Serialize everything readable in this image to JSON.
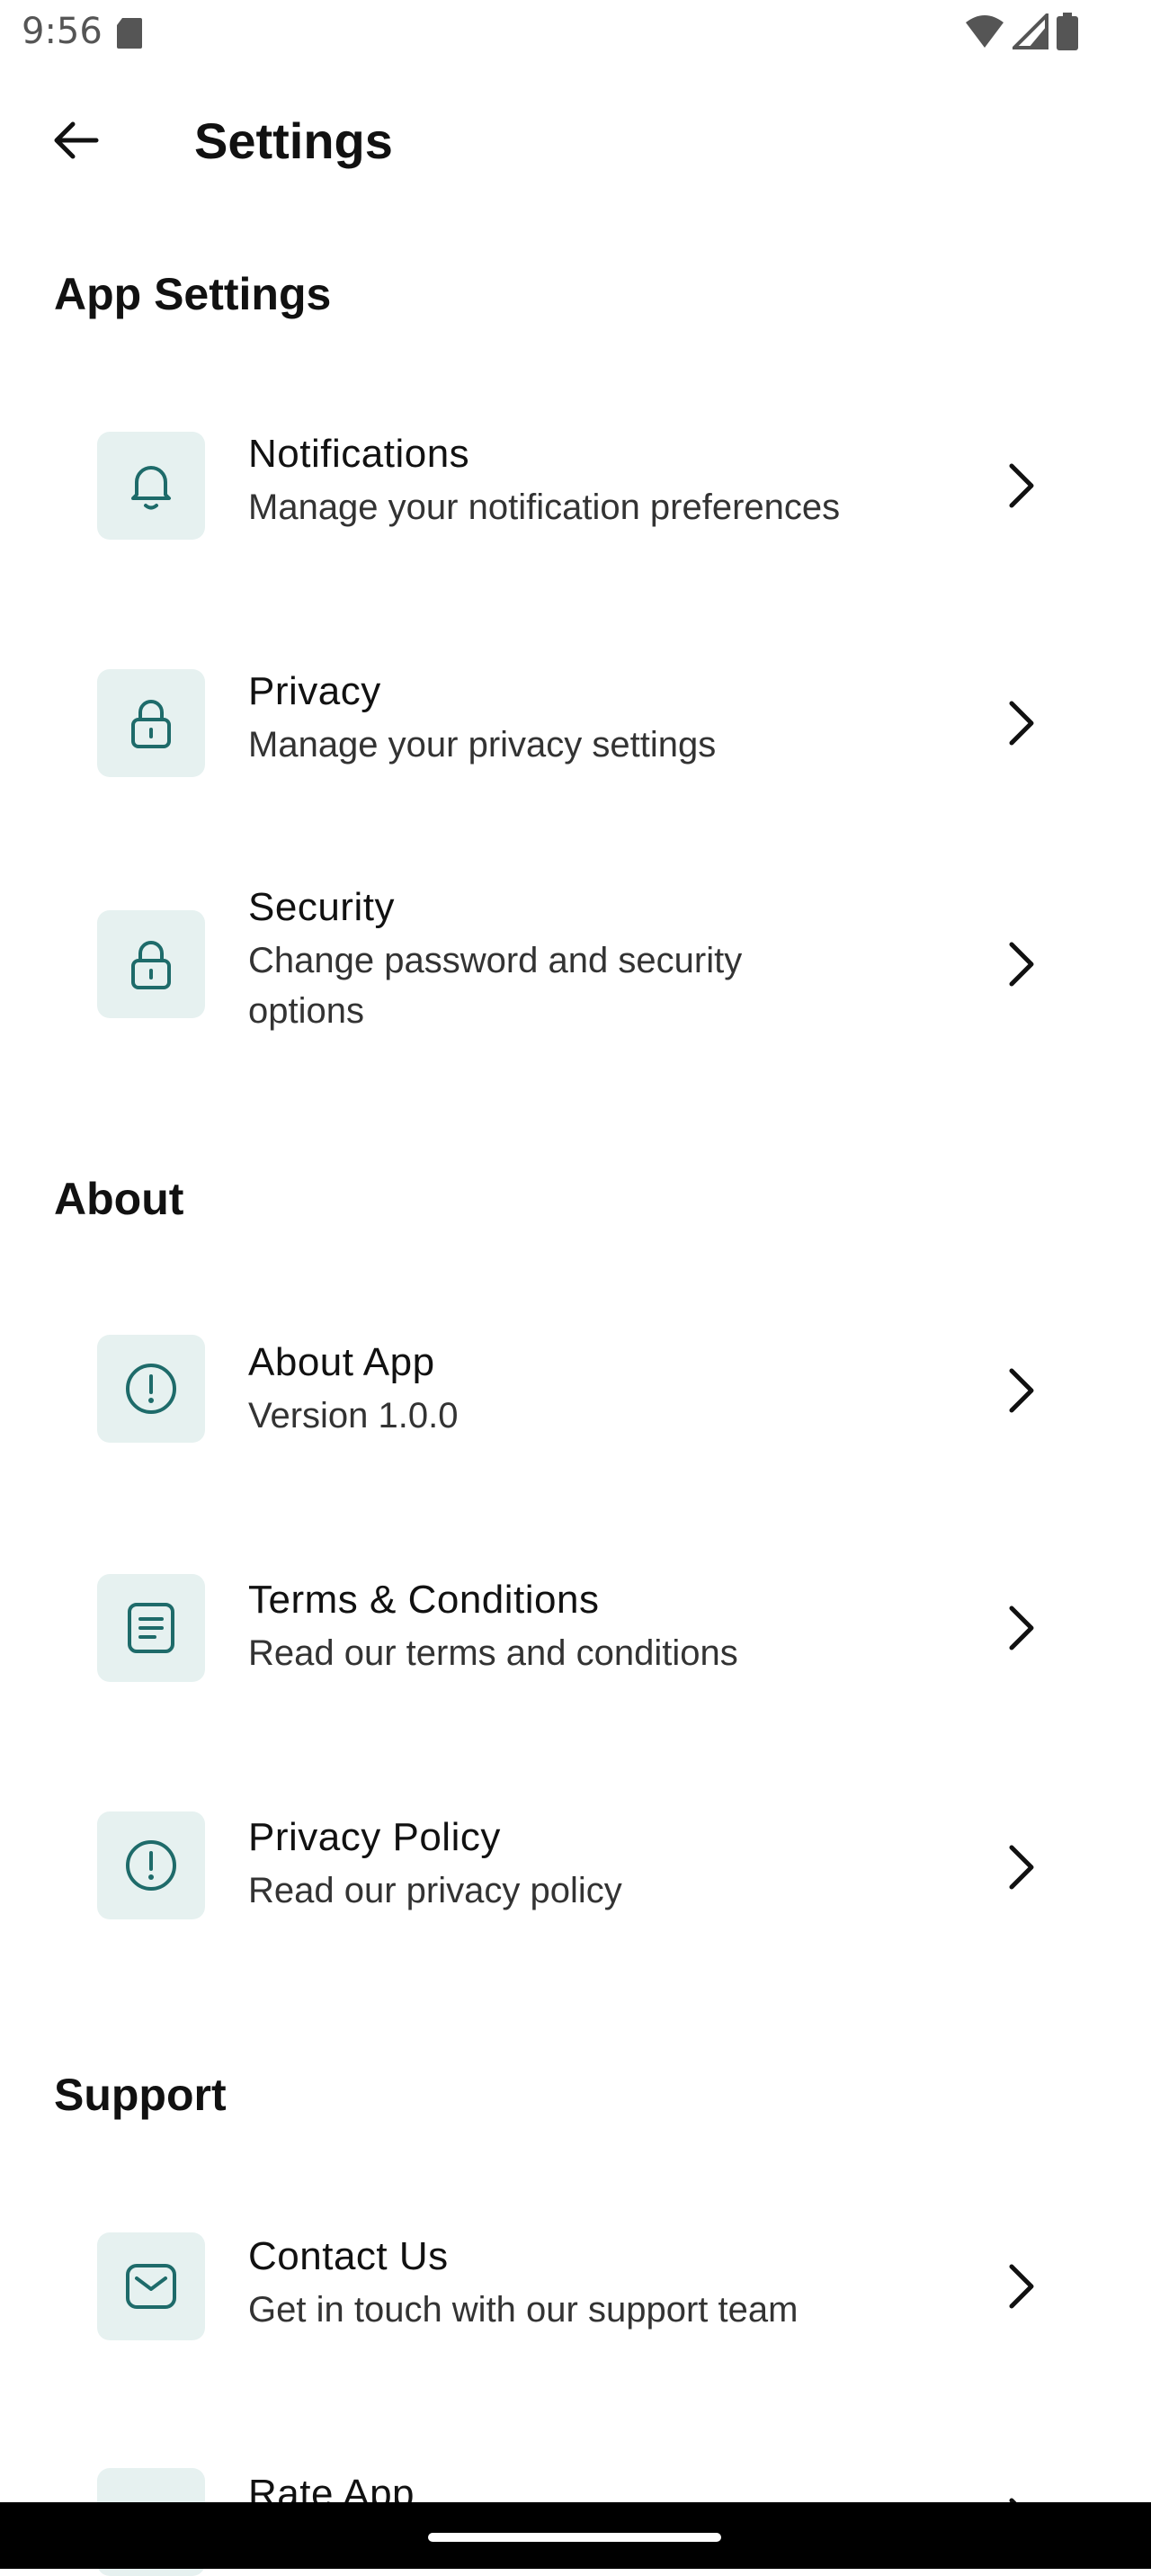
{
  "status_bar": {
    "time": "9:56"
  },
  "app_bar": {
    "title": "Settings"
  },
  "sections": [
    {
      "title": "App Settings",
      "items": [
        {
          "title": "Notifications",
          "subtitle": "Manage your notification preferences",
          "icon": "bell-icon"
        },
        {
          "title": "Privacy",
          "subtitle": "Manage your privacy settings",
          "icon": "lock-icon"
        },
        {
          "title": "Security",
          "subtitle": "Change password and security options",
          "icon": "lock-icon"
        }
      ]
    },
    {
      "title": "About",
      "items": [
        {
          "title": "About App",
          "subtitle": "Version 1.0.0",
          "icon": "info-icon"
        },
        {
          "title": "Terms & Conditions",
          "subtitle": "Read our terms and conditions",
          "icon": "document-icon"
        },
        {
          "title": "Privacy Policy",
          "subtitle": "Read our privacy policy",
          "icon": "info-icon"
        }
      ]
    },
    {
      "title": "Support",
      "items": [
        {
          "title": "Contact Us",
          "subtitle": "Get in touch with our support team",
          "icon": "mail-icon"
        },
        {
          "title": "Rate App",
          "subtitle": "",
          "icon": "heart-icon"
        }
      ]
    }
  ],
  "colors": {
    "accent": "#1e6b6a",
    "tile_background": "#e6f1f0",
    "text_primary": "#111111",
    "text_secondary": "#333333"
  }
}
